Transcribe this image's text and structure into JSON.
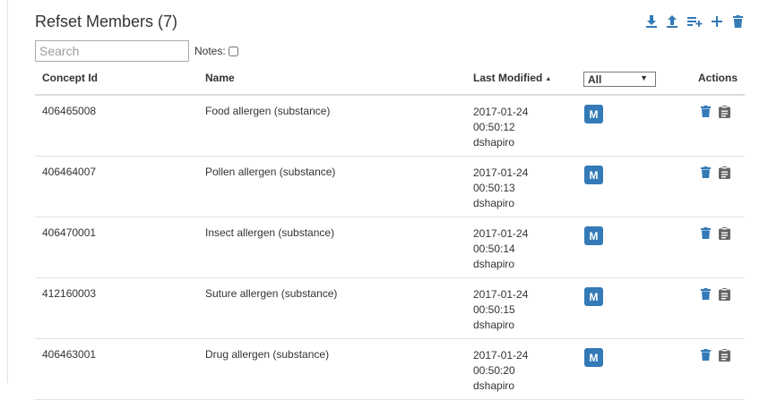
{
  "header": {
    "title": "Refset Members (7)"
  },
  "toolbar": {
    "icons": [
      "download-icon",
      "upload-icon",
      "add-list-icon",
      "plus-icon",
      "trash-icon"
    ]
  },
  "search": {
    "placeholder": "Search",
    "value": ""
  },
  "notes": {
    "label": "Notes:",
    "checked": false
  },
  "table": {
    "columns": {
      "concept_id": "Concept Id",
      "name": "Name",
      "last_modified": "Last Modified",
      "actions": "Actions"
    },
    "sort": {
      "column": "Last Modified",
      "direction": "ascending",
      "indicator": "▲"
    },
    "filter": {
      "selected": "All"
    },
    "rows": [
      {
        "concept_id": "406465008",
        "name": "Food allergen (substance)",
        "date": "2017-01-24",
        "time": "00:50:12",
        "user": "dshapiro",
        "badge": "M"
      },
      {
        "concept_id": "406464007",
        "name": "Pollen allergen (substance)",
        "date": "2017-01-24",
        "time": "00:50:13",
        "user": "dshapiro",
        "badge": "M"
      },
      {
        "concept_id": "406470001",
        "name": "Insect allergen (substance)",
        "date": "2017-01-24",
        "time": "00:50:14",
        "user": "dshapiro",
        "badge": "M"
      },
      {
        "concept_id": "412160003",
        "name": "Suture allergen (substance)",
        "date": "2017-01-24",
        "time": "00:50:15",
        "user": "dshapiro",
        "badge": "M"
      },
      {
        "concept_id": "406463001",
        "name": "Drug allergen (substance)",
        "date": "2017-01-24",
        "time": "00:50:20",
        "user": "dshapiro",
        "badge": "M"
      }
    ]
  },
  "colors": {
    "accent": "#337ab7",
    "action_icon": "#666666"
  }
}
